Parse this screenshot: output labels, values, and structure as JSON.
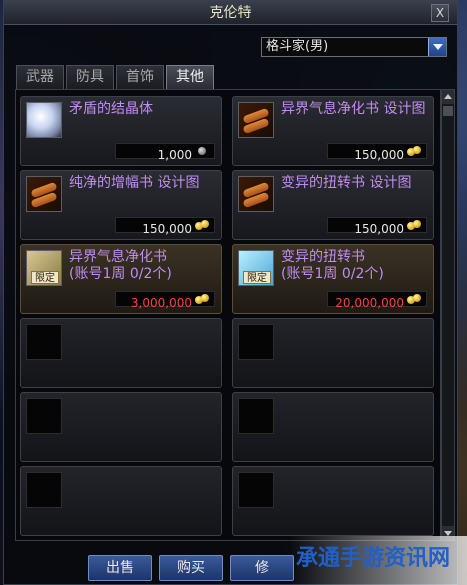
{
  "window": {
    "title": "克伦特",
    "close_label": "X"
  },
  "class_filter": {
    "selected": "格斗家(男)"
  },
  "tabs": [
    {
      "label": "武器",
      "active": false
    },
    {
      "label": "防具",
      "active": false
    },
    {
      "label": "首饰",
      "active": false
    },
    {
      "label": "其他",
      "active": true
    }
  ],
  "items": [
    {
      "name": "矛盾的结晶体",
      "price": "1,000",
      "currency_icon": "gray-coin-icon",
      "limited": false,
      "icon": "crystal-icon"
    },
    {
      "name": "异界气息净化书  设计图",
      "price": "150,000",
      "currency_icon": "gold-coin-icon",
      "limited": false,
      "icon": "scroll-icon"
    },
    {
      "name": "纯净的增幅书  设计图",
      "price": "150,000",
      "currency_icon": "gold-coin-icon",
      "limited": false,
      "icon": "scroll-icon"
    },
    {
      "name": "变异的扭转书  设计图",
      "price": "150,000",
      "currency_icon": "gold-coin-icon",
      "limited": false,
      "icon": "scroll-icon"
    },
    {
      "name": "异界气息净化书\n(账号1周 0/2个)",
      "price": "3,000,000",
      "currency_icon": "gold-coin-icon",
      "limited": true,
      "badge": "限定",
      "icon": "book-icon"
    },
    {
      "name": "变异的扭转书\n(账号1周 0/2个)",
      "price": "20,000,000",
      "currency_icon": "gold-coin-icon",
      "limited": true,
      "badge": "限定",
      "icon": "book-icon"
    }
  ],
  "buttons": {
    "sell": "出售",
    "buy": "购买",
    "third": "修"
  },
  "watermark": {
    "text": "承通手游资讯网"
  },
  "colors": {
    "item_name": "#c08cf0",
    "limited_price": "#ff4040",
    "button": "#2a4a88"
  }
}
